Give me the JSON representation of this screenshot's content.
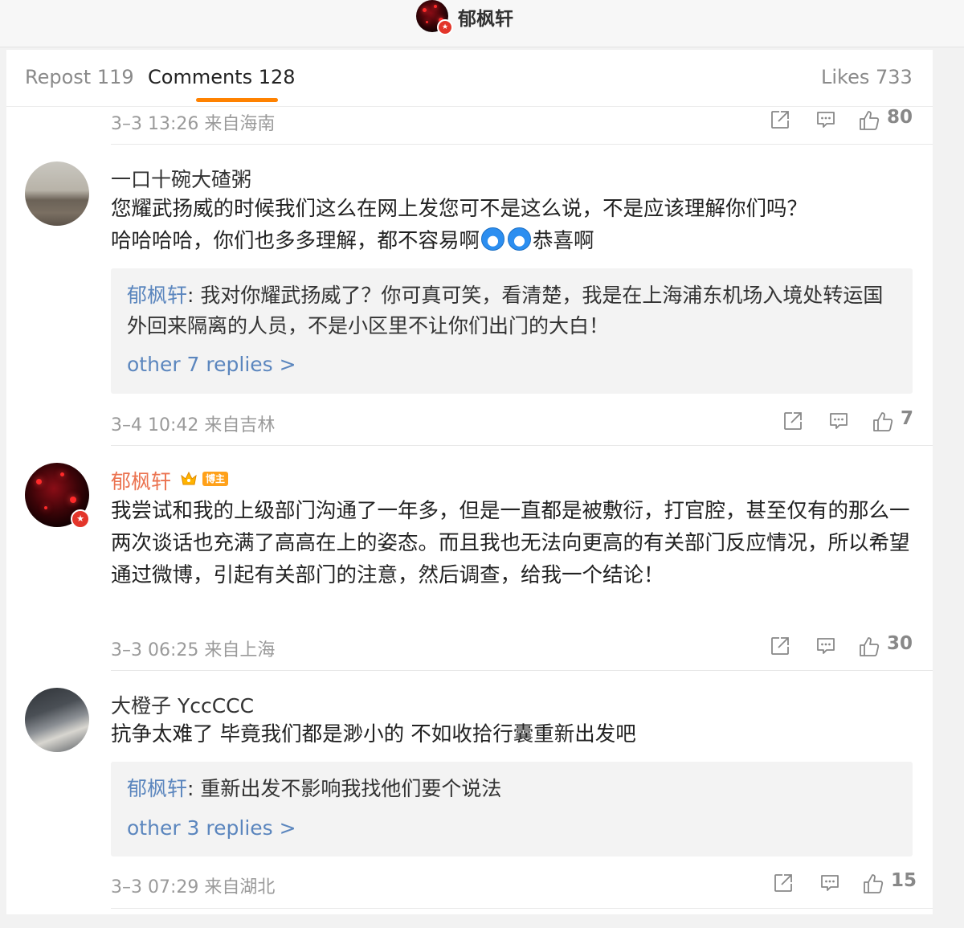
{
  "header": {
    "title": "郁枫轩"
  },
  "tabs": {
    "repost": "Repost 119",
    "comments": "Comments 128",
    "likes": "Likes 733"
  },
  "colors": {
    "accent": "#ff8200",
    "link": "#5b86be",
    "owner_name": "#eb7350"
  },
  "icons": [
    "share-icon",
    "comment-icon",
    "like-icon",
    "verified-icon",
    "crown-icon"
  ],
  "partial_comment": {
    "meta": "3–3 13:26 来自海南",
    "likes": "80"
  },
  "comments": [
    {
      "username": "一口十碗大碴粥",
      "text_line1": "您耀武扬威的时候我们这么在网上发您可不是这么说，不是应该理解你们吗？",
      "text_line2_a": "哈哈哈哈，你们也多多理解，都不容易啊",
      "text_line2_b": "恭喜啊",
      "reply_user": "郁枫轩",
      "reply_text": ": 我对你耀武扬威了？你可真可笑，看清楚，我是在上海浦东机场入境处转运国外回来隔离的人员，不是小区里不让你们出门的大白！",
      "more_replies": "other 7 replies >",
      "meta": "3–4 10:42 来自吉林",
      "likes": "7"
    },
    {
      "username": "郁枫轩",
      "author_badge": "博主",
      "text": "我尝试和我的上级部门沟通了一年多，但是一直都是被敷衍，打官腔，甚至仅有的那么一两次谈话也充满了高高在上的姿态。而且我也无法向更高的有关部门反应情况，所以希望通过微博，引起有关部门的注意，然后调查，给我一个结论！",
      "meta": "3–3 06:25 来自上海",
      "likes": "30"
    },
    {
      "username": "大橙子 YccCCC",
      "text": "抗争太难了 毕竟我们都是渺小的 不如收拾行囊重新出发吧",
      "reply_user": "郁枫轩",
      "reply_text": ": 重新出发不影响我找他们要个说法",
      "more_replies": "other 3 replies >",
      "meta": "3–3 07:29 来自湖北",
      "likes": "15"
    }
  ]
}
